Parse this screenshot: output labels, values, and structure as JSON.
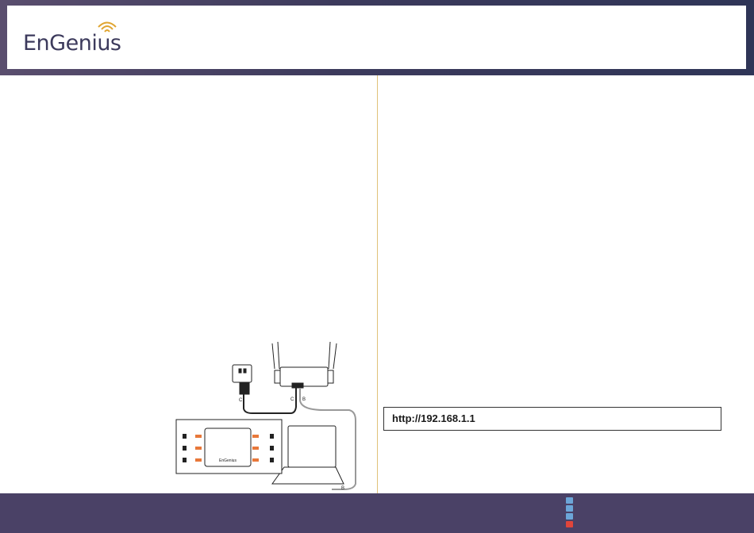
{
  "header": {
    "brand": "EnGenius",
    "brand_color": "#3c3a5c",
    "wifi_color": "#e0a531"
  },
  "diagram": {
    "label_c1": "C",
    "label_c2": "C",
    "label_b1": "B",
    "label_b2": "B",
    "device_brand": "EnGenius"
  },
  "url_box": {
    "text": "http://192.168.1.1"
  },
  "footer": {
    "nav_icons": [
      "first-page-icon",
      "prev-page-icon",
      "next-page-icon",
      "last-page-icon"
    ],
    "nav_colors": [
      "#6ca6d8",
      "#6ca6d8",
      "#6ca6d8",
      "#e0453b"
    ]
  }
}
